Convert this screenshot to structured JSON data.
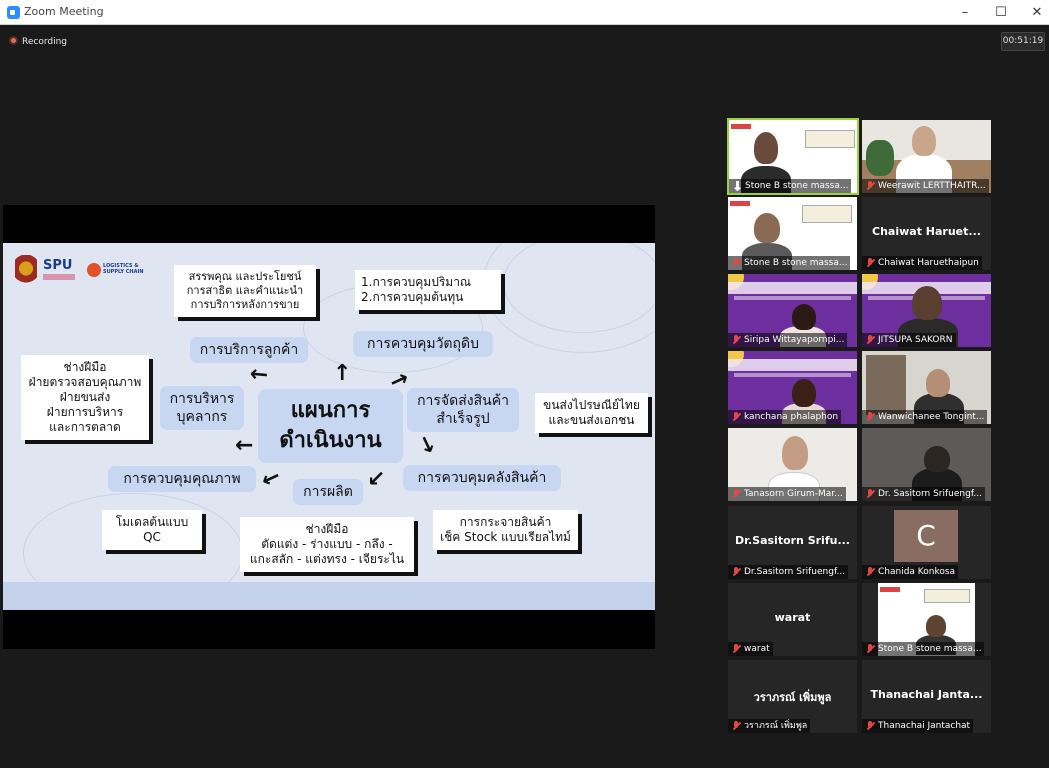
{
  "window": {
    "title": "Zoom Meeting",
    "minimize": "–",
    "maximize": "☐",
    "close": "✕"
  },
  "recording": {
    "label": "Recording"
  },
  "timer": "00:51:19",
  "slide": {
    "logo_spu": "SPU",
    "logo_lsc": "LOGISTICS & SUPPLY CHAIN",
    "center": [
      "แผนการ",
      "ดำเนินงาน"
    ],
    "nodes": {
      "customer_service": "การบริการลูกค้า",
      "material_control": "การควบคุมวัตถุดิบ",
      "hr": [
        "การบริหาร",
        "บุคลากร"
      ],
      "finished_goods": [
        "การจัดส่งสินค้า",
        "สำเร็จรูป"
      ],
      "quality_control": "การควบคุมคุณภาพ",
      "production": "การผลิต",
      "inventory_control": "การควบคุมคลังสินค้า"
    },
    "notes": {
      "welfare": [
        "สรรพคุณ และประโยชน์",
        "การสาธิต และคำแนะนำ",
        "การบริการหลังการขาย"
      ],
      "quantity_cost": [
        "1.การควบคุมปริมาณ",
        "2.การควบคุมต้นทุน"
      ],
      "staff": [
        "ช่างฝีมือ",
        "ฝ่ายตรวจสอบคุณภาพ",
        "ฝ่ายขนส่ง",
        "ฝ่ายการบริหาร",
        "และการตลาด"
      ],
      "shipping": [
        "ขนส่งไปรษณีย์ไทย",
        "และขนส่งเอกชน"
      ],
      "qc_model": [
        "โมเดลต้นแบบ",
        "QC"
      ],
      "craft": [
        "ช่างฝีมือ",
        "ตัดแต่ง - ร่างแบบ - กลึง -",
        "แกะสลัก - แต่งทรง - เจียระไน"
      ],
      "distribution": [
        "การกระจายสินค้า",
        "เช็ค Stock แบบเรียลไทม์"
      ]
    }
  },
  "participants": [
    {
      "name": "Stone B stone massa...",
      "muted": false,
      "pinned": true,
      "active": true,
      "type": "video-slide-woman"
    },
    {
      "name": "Weerawit LERTTHAITR...",
      "muted": true,
      "type": "video-man-office"
    },
    {
      "name": "Stone B stone massa...",
      "muted": true,
      "type": "video-slide-man"
    },
    {
      "name": "Chaiwat Haruethaipun",
      "big_name": "Chaiwat  Haruet...",
      "muted": true,
      "type": "name"
    },
    {
      "name": "Siripa Wittayapornpi...",
      "muted": true,
      "type": "video-purple-woman"
    },
    {
      "name": "JITSUPA  SAKORN",
      "muted": true,
      "type": "video-purple-man"
    },
    {
      "name": "kanchana phalaphon",
      "muted": true,
      "type": "video-purple-woman2"
    },
    {
      "name": "Wanwichanee Tongint...",
      "muted": true,
      "type": "video-room-woman"
    },
    {
      "name": "Tanasorn Girum-Mar...",
      "muted": true,
      "type": "video-girl"
    },
    {
      "name": "Dr. Sasitorn Srifuengf...",
      "muted": true,
      "type": "video-dark"
    },
    {
      "name": "Dr.Sasitorn Srifuengf...",
      "big_name": "Dr.Sasitorn  Srifu...",
      "muted": true,
      "type": "name"
    },
    {
      "name": "Chanida Konkosa",
      "avatar_letter": "C",
      "muted": true,
      "type": "avatar"
    },
    {
      "name": "warat",
      "big_name": "warat",
      "muted": true,
      "type": "name"
    },
    {
      "name": "Stone B stone massa...",
      "muted": true,
      "type": "video-slide-small"
    },
    {
      "name": "วราภรณ์ เพิ่มพูล",
      "big_name": "วราภรณ์ เพิ่มพูล",
      "muted": true,
      "type": "name"
    },
    {
      "name": "Thanachai Jantachat",
      "big_name": "Thanachai  Janta...",
      "muted": true,
      "type": "name"
    }
  ]
}
